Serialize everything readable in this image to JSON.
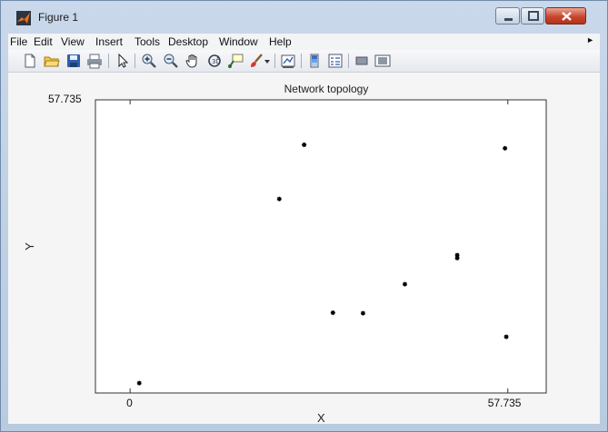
{
  "window": {
    "title": "Figure 1"
  },
  "menubar": {
    "items": [
      "File",
      "Edit",
      "View",
      "Insert",
      "Tools",
      "Desktop",
      "Window",
      "Help"
    ],
    "overflow_icon": "chevron-right-icon"
  },
  "toolbar": {
    "icons": [
      "new-figure-icon",
      "open-file-icon",
      "save-icon",
      "print-icon",
      "edit-plot-arrow-icon",
      "zoom-in-icon",
      "zoom-out-icon",
      "pan-hand-icon",
      "rotate-3d-icon",
      "data-cursor-icon",
      "brush-icon",
      "brush-dropdown-icon",
      "link-plot-icon",
      "colorbar-icon",
      "legend-icon",
      "hide-plot-tools-icon",
      "show-plot-tools-icon"
    ]
  },
  "colors": {
    "title_bar": "#c9d8ea",
    "close_button": "#c8472e",
    "figure_background": "#f5f5f5",
    "axes_background": "#ffffff",
    "marker": "#000000"
  },
  "chart_data": {
    "type": "scatter",
    "title": "Network topology",
    "xlabel": "X",
    "ylabel": "Y",
    "xlim": [
      -5.3,
      63.6
    ],
    "ylim": [
      -1.8,
      57.735
    ],
    "xticks": [
      0,
      57.735
    ],
    "xtick_labels": [
      "0",
      "57.735"
    ],
    "yticks": [
      57.735
    ],
    "ytick_labels": [
      "57.735"
    ],
    "grid": false,
    "marker": "*",
    "series": [
      {
        "points": [
          {
            "x": 1.4,
            "y": 0.2
          },
          {
            "x": 22.8,
            "y": 37.6
          },
          {
            "x": 26.6,
            "y": 48.6
          },
          {
            "x": 31.0,
            "y": 14.5
          },
          {
            "x": 35.6,
            "y": 14.4
          },
          {
            "x": 42.0,
            "y": 20.3
          },
          {
            "x": 50.0,
            "y": 26.2
          },
          {
            "x": 50.0,
            "y": 25.6
          },
          {
            "x": 57.3,
            "y": 47.9
          },
          {
            "x": 57.5,
            "y": 9.6
          }
        ]
      }
    ]
  }
}
